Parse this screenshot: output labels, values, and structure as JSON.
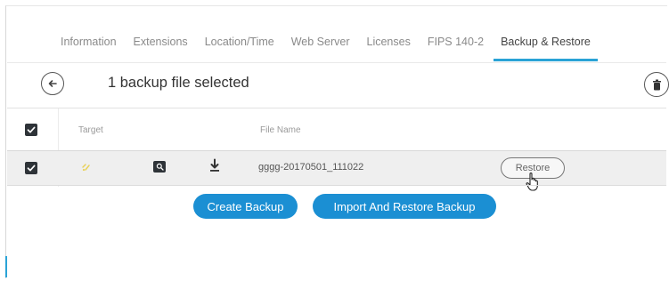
{
  "tabs": [
    {
      "label": "Information",
      "active": false
    },
    {
      "label": "Extensions",
      "active": false
    },
    {
      "label": "Location/Time",
      "active": false
    },
    {
      "label": "Web Server",
      "active": false
    },
    {
      "label": "Licenses",
      "active": false
    },
    {
      "label": "FIPS 140-2",
      "active": false
    },
    {
      "label": "Backup & Restore",
      "active": true
    }
  ],
  "header": {
    "selection_text": "1 backup file selected",
    "back_icon": "arrow-left-icon",
    "delete_icon": "trash-icon"
  },
  "table": {
    "columns": {
      "target": "Target",
      "file_name": "File Name"
    },
    "rows": [
      {
        "checked": true,
        "target_icon": "sparkle-icon",
        "view_icon": "search-icon",
        "download_icon": "download-icon",
        "file_name": "gggg-20170501_111022",
        "action_label": "Restore"
      }
    ]
  },
  "actions": {
    "create_backup": "Create Backup",
    "import_restore": "Import And Restore Backup"
  },
  "colors": {
    "accent": "#2aa3d6",
    "primary_button": "#1b8fd3",
    "checkbox": "#2e3338",
    "target_icon": "#e8d25a"
  }
}
